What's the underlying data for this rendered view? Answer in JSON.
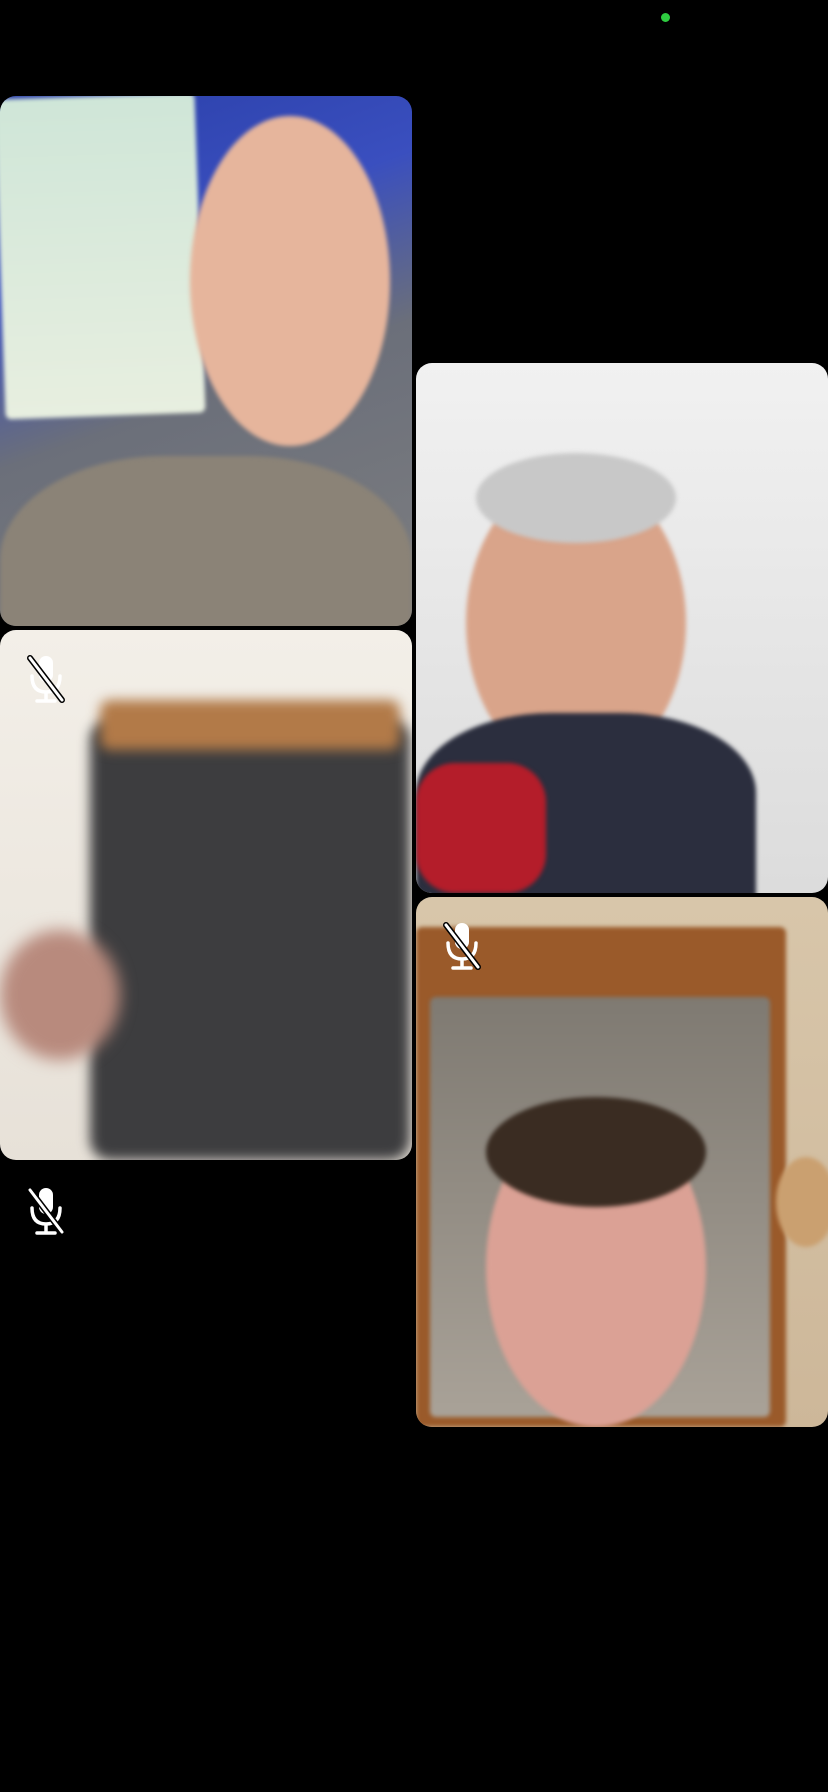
{
  "status": {
    "indicator_color": "#2ecc40"
  },
  "participants": [
    {
      "id": "p1",
      "muted": false,
      "tile_color": "#5f6675"
    },
    {
      "id": "p2",
      "muted": false,
      "tile_color": "#e9e9e9"
    },
    {
      "id": "p3",
      "muted": true,
      "tile_color": "#c9c3b8",
      "mic_icon": "mic-off-icon"
    },
    {
      "id": "p4",
      "muted": true,
      "tile_color": "#cbb79b",
      "mic_icon": "mic-off-icon"
    }
  ],
  "self": {
    "muted": true,
    "mic_icon": "mic-off-icon"
  }
}
